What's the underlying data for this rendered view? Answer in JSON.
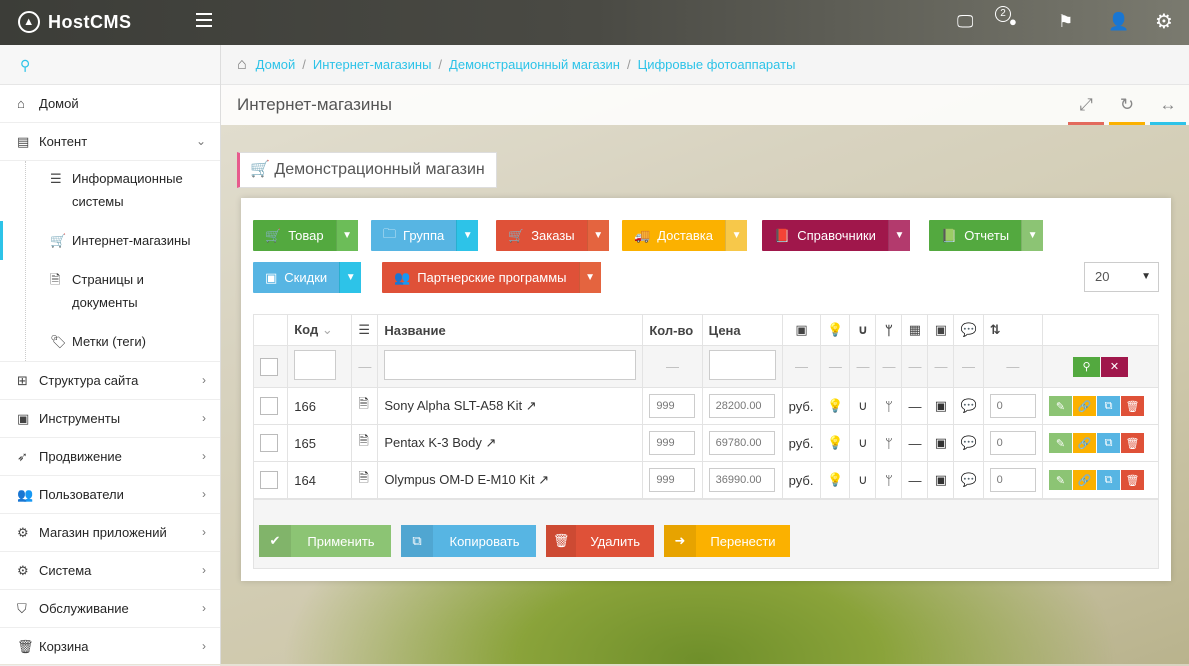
{
  "app": {
    "title": "HostCMS",
    "notif_count": "2"
  },
  "sidebar": {
    "search_icon": "search-icon",
    "items": [
      {
        "label": "Домой",
        "icon": "home-icon"
      },
      {
        "label": "Контент",
        "icon": "content-icon"
      },
      {
        "label": "Структура сайта",
        "icon": "sitemap-icon"
      },
      {
        "label": "Инструменты",
        "icon": "tools-icon"
      },
      {
        "label": "Продвижение",
        "icon": "rocket-icon"
      },
      {
        "label": "Пользователи",
        "icon": "users-icon"
      },
      {
        "label": "Магазин приложений",
        "icon": "apps-icon"
      },
      {
        "label": "Система",
        "icon": "gear-icon"
      },
      {
        "label": "Обслуживание",
        "icon": "shield-icon"
      },
      {
        "label": "Корзина",
        "icon": "trash-icon"
      }
    ],
    "subitems": [
      {
        "label": "Информационные системы"
      },
      {
        "label": "Интернет-магазины"
      },
      {
        "label": "Страницы и документы"
      },
      {
        "label": "Метки (теги)"
      }
    ]
  },
  "breadcrumb": [
    "Домой",
    "Интернет-магазины",
    "Демонстрационный магазин",
    "Цифровые фотоаппараты"
  ],
  "page": {
    "title": "Интернет-магазины",
    "tab_title": "Демонстрационный магазин"
  },
  "toolbar": {
    "tovar": "Товар",
    "gruppa": "Группа",
    "zakazy": "Заказы",
    "dostavka": "Доставка",
    "spravochniki": "Справочники",
    "otchety": "Отчеты",
    "skidki": "Скидки",
    "partner": "Партнерские программы",
    "page_size": "20"
  },
  "table": {
    "headers": {
      "code": "Код",
      "name": "Название",
      "qty": "Кол-во",
      "price": "Цена"
    },
    "rows": [
      {
        "code": "166",
        "name": "Sony Alpha SLT-A58 Kit",
        "qty": "999",
        "price": "28200.00",
        "currency": "руб.",
        "sort": "0"
      },
      {
        "code": "165",
        "name": "Pentax K-3 Body",
        "qty": "999",
        "price": "69780.00",
        "currency": "руб.",
        "sort": "0"
      },
      {
        "code": "164",
        "name": "Olympus OM-D E-M10 Kit",
        "qty": "999",
        "price": "36990.00",
        "currency": "руб.",
        "sort": "0"
      }
    ]
  },
  "bottom": {
    "apply": "Применить",
    "copy": "Копировать",
    "delete": "Удалить",
    "move": "Перенести"
  },
  "colors": {
    "accent": "#2dc3e8",
    "green": "#53a93f",
    "blue": "#57b5e3",
    "red": "#df5138",
    "orange": "#fbb100",
    "maroon": "#a0174b",
    "lime": "#8cc474"
  }
}
